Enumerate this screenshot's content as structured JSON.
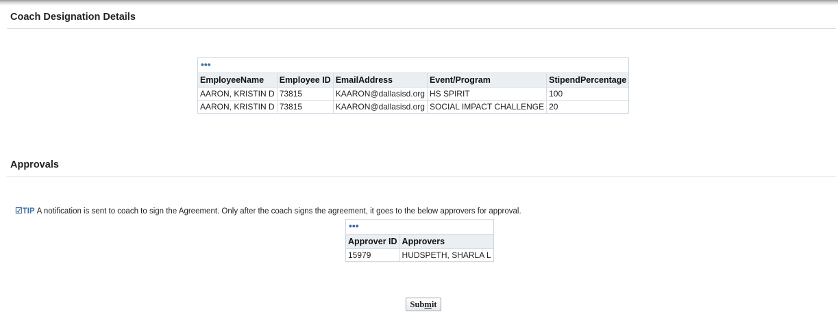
{
  "coach_section": {
    "title": "Coach Designation Details",
    "table": {
      "toolbar_icon": "more-options-icon",
      "columns": [
        "EmployeeName",
        "Employee ID",
        "EmailAddress",
        "Event/Program",
        "StipendPercentage"
      ],
      "rows": [
        [
          "AARON, KRISTIN D",
          "73815",
          "KAARON@dallasisd.org",
          "HS SPIRIT",
          "100"
        ],
        [
          "AARON, KRISTIN D",
          "73815",
          "KAARON@dallasisd.org",
          "SOCIAL IMPACT CHALLENGE",
          "20"
        ]
      ]
    }
  },
  "approvals_section": {
    "title": "Approvals",
    "tip": {
      "icon": "tip-check-icon",
      "label": "TIP",
      "text": "A notification is sent to coach to sign the Agreement. Only after the coach signs the agreement, it goes to the below approvers for approval."
    },
    "table": {
      "toolbar_icon": "more-options-icon",
      "columns": [
        "Approver ID",
        "Approvers"
      ],
      "rows": [
        [
          "15979",
          "HUDSPETH, SHARLA L"
        ]
      ]
    }
  },
  "submit_button": {
    "label": "Submit",
    "accelerator": "m"
  },
  "colors": {
    "header_bg": "#eaeff3",
    "accent": "#3e6fa3"
  }
}
